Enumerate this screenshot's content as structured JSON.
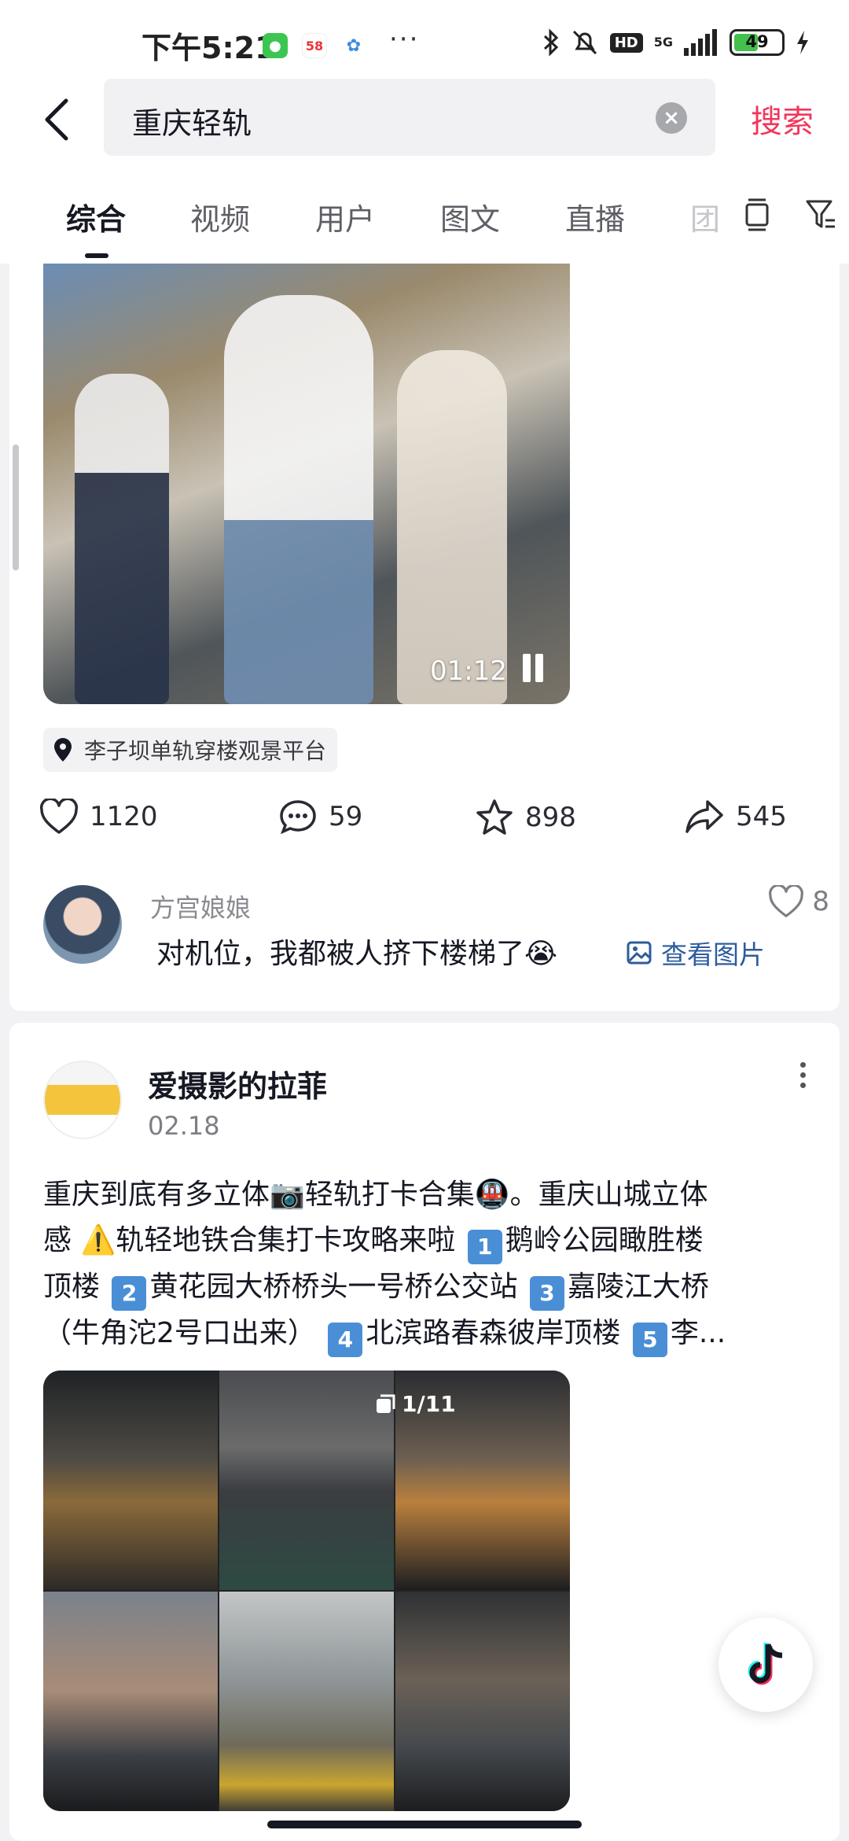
{
  "status_bar": {
    "time": "下午5:21",
    "app_icons": [
      "wechat-icon",
      "58-app-icon",
      "cloud-app-icon"
    ],
    "more": "···",
    "hd": "HD",
    "network": "5G",
    "battery": "49"
  },
  "search": {
    "query": "重庆轻轨",
    "search_label": "搜索"
  },
  "tabs": [
    {
      "label": "综合",
      "active": true
    },
    {
      "label": "视频"
    },
    {
      "label": "用户"
    },
    {
      "label": "图文"
    },
    {
      "label": "直播"
    },
    {
      "label": "团"
    }
  ],
  "post1": {
    "duration": "01:12",
    "location": "李子坝单轨穿楼观景平台",
    "likes": "1120",
    "comments": "59",
    "favorites": "898",
    "shares": "545",
    "top_comment": {
      "user": "方宫娘娘",
      "text": "对机位，我都被人挤下楼梯了😭",
      "view_image": "查看图片",
      "likes": "8"
    }
  },
  "post2": {
    "author": "爱摄影的拉菲",
    "date": "02.18",
    "text_line1": "重庆到底有多立体📷轻轨打卡合集🚇。重庆山城立体",
    "text_line2_a": "感 ⚠️轨轻地铁合集打卡攻略来啦 ",
    "text_line2_b": "鹅岭公园瞰胜楼",
    "text_line3_a": "顶楼 ",
    "text_line3_b": "黄花园大桥桥头一号桥公交站 ",
    "text_line3_c": "嘉陵江大桥",
    "text_line4_a": "（牛角沱2号口出来） ",
    "text_line4_b": "北滨路春森彼岸顶楼 ",
    "text_line4_c": "李...",
    "nums": [
      "1",
      "2",
      "3",
      "4",
      "5"
    ],
    "image_counter": "1/11"
  }
}
